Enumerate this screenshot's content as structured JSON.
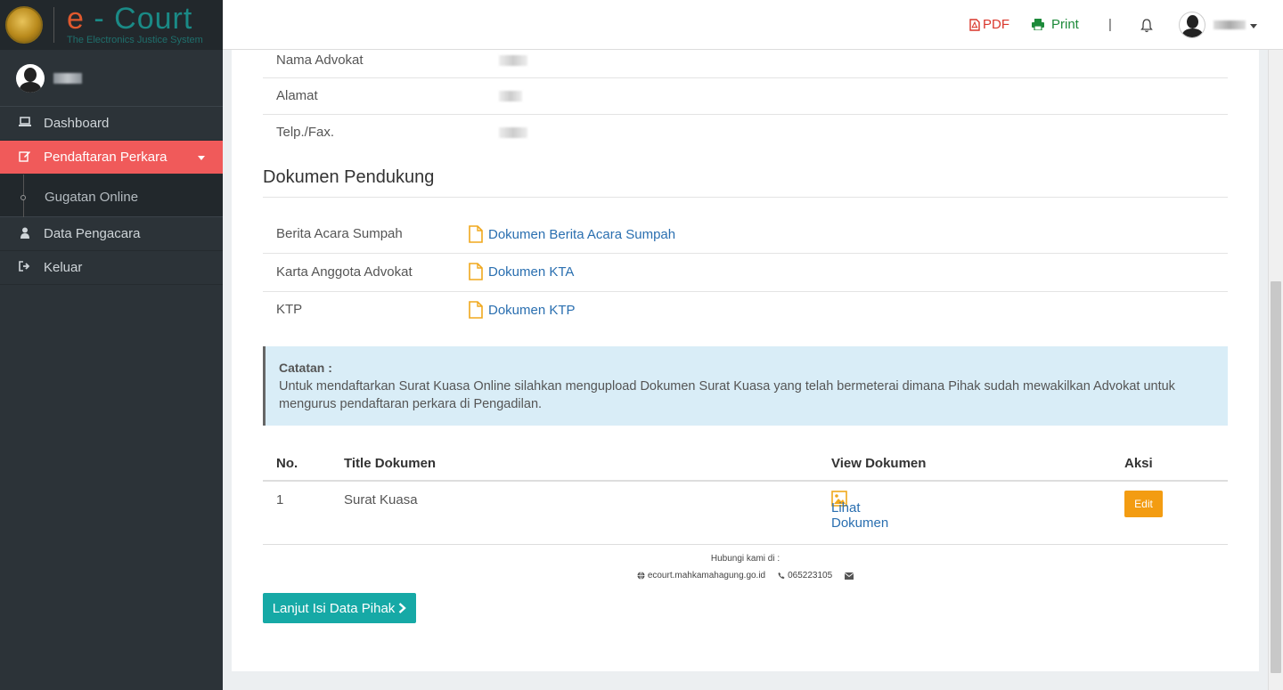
{
  "brand": {
    "title_e": "e",
    "title_rest": " - Court",
    "subtitle": "The Electronics Justice System"
  },
  "sidebar": {
    "items": [
      {
        "label": "Dashboard",
        "icon": "laptop-icon"
      },
      {
        "label": "Pendaftaran Perkara",
        "icon": "edit-icon",
        "active": true
      },
      {
        "label": "Data Pengacara",
        "icon": "user-icon"
      },
      {
        "label": "Keluar",
        "icon": "sign-out-icon"
      }
    ],
    "subitems": [
      {
        "label": "Gugatan Online"
      }
    ]
  },
  "topbar": {
    "pdf_label": "PDF",
    "print_label": "Print",
    "separator": "|"
  },
  "advokat_info": {
    "rows": [
      {
        "label": "Nama Advokat"
      },
      {
        "label": "Alamat"
      },
      {
        "label": "Telp./Fax."
      }
    ]
  },
  "dokumen_pendukung": {
    "title": "Dokumen Pendukung",
    "rows": [
      {
        "label": "Berita Acara Sumpah",
        "link": "Dokumen Berita Acara Sumpah"
      },
      {
        "label": "Karta Anggota Advokat",
        "link": "Dokumen KTA"
      },
      {
        "label": "KTP",
        "link": "Dokumen KTP"
      }
    ]
  },
  "note": {
    "title": "Catatan :",
    "text": "Untuk mendaftarkan Surat Kuasa Online silahkan mengupload Dokumen Surat Kuasa yang telah bermeterai dimana Pihak sudah mewakilkan Advokat untuk mengurus pendaftaran perkara di Pengadilan."
  },
  "table": {
    "headers": {
      "no": "No.",
      "title": "Title Dokumen",
      "view": "View Dokumen",
      "aksi": "Aksi"
    },
    "rows": [
      {
        "no": "1",
        "title": "Surat Kuasa",
        "view": "Lihat Dokumen",
        "action": "Edit"
      }
    ]
  },
  "contact": {
    "heading": "Hubungi kami di :",
    "website": "ecourt.mahkamahagung.go.id",
    "phone": "065223105"
  },
  "next_button": {
    "label": "Lanjut Isi Data Pihak"
  },
  "colors": {
    "accent_red": "#f05a5a",
    "teal": "#16a9a6",
    "edit_orange": "#f39c12",
    "link_blue": "#2a6fb0",
    "sidebar_bg": "#2c3338"
  }
}
